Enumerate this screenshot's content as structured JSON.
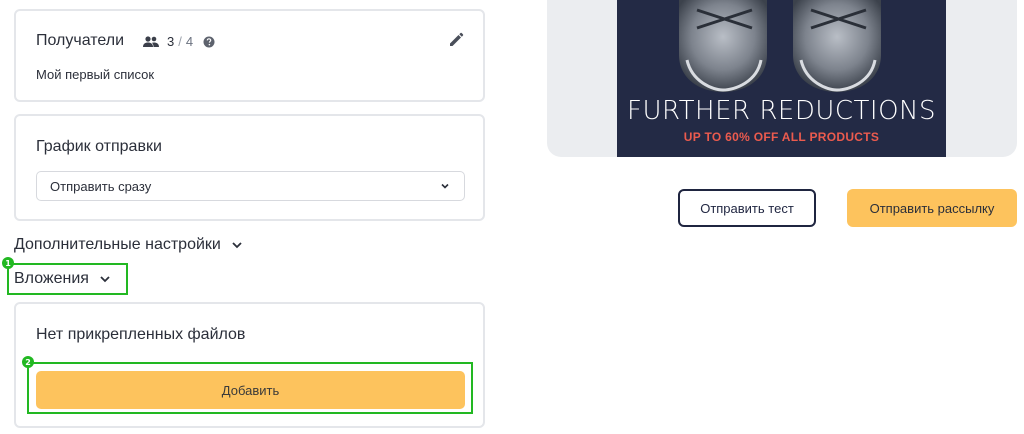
{
  "recipients": {
    "title": "Получатели",
    "count": "3",
    "separator": "/",
    "limit": "4",
    "list_name": "Мой первый список"
  },
  "schedule": {
    "title": "График отправки",
    "selected": "Отправить сразу"
  },
  "advanced": {
    "label": "Дополнительные настройки"
  },
  "attachments": {
    "label": "Вложения",
    "empty_text": "Нет прикрепленных файлов",
    "add_label": "Добавить"
  },
  "preview": {
    "headline": "FURTHER REDUCTIONS",
    "subline": "UP TO 60% OFF ALL PRODUCTS"
  },
  "actions": {
    "test_label": "Отправить тест",
    "send_label": "Отправить рассылку"
  },
  "annotations": {
    "marker_1": "1",
    "marker_2": "2"
  },
  "colors": {
    "accent": "#fdc35d",
    "highlight": "#22b822",
    "banner_bg": "#232a45",
    "banner_sub": "#ec5b4e"
  }
}
